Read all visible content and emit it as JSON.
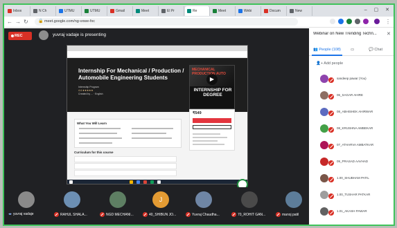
{
  "browser": {
    "tabs": [
      {
        "label": "Inbox",
        "favicon": "gmail-icon",
        "color": "#d93025"
      },
      {
        "label": "N Ch",
        "favicon": "page-icon",
        "color": "#5f6368"
      },
      {
        "label": "UTMU",
        "favicon": "page-icon",
        "color": "#1a73e8"
      },
      {
        "label": "UTMU",
        "favicon": "sheets-icon",
        "color": "#188038"
      },
      {
        "label": "Gmail",
        "favicon": "gmail-icon",
        "color": "#d93025"
      },
      {
        "label": "Meet",
        "favicon": "meet-icon",
        "color": "#00897b"
      },
      {
        "label": "El Pr",
        "favicon": "page-icon",
        "color": "#5f6368"
      },
      {
        "label": "Re",
        "favicon": "meet-icon",
        "color": "#00897b"
      },
      {
        "label": "Meet",
        "favicon": "meet-icon",
        "color": "#188038"
      },
      {
        "label": "Webi",
        "favicon": "page-icon",
        "color": "#1a73e8"
      },
      {
        "label": "Docum",
        "favicon": "youtube-icon",
        "color": "#d93025"
      },
      {
        "label": "New",
        "favicon": "page-icon",
        "color": "#5f6368"
      }
    ],
    "url": "meet.google.com/ng-vxwe-fxc",
    "window_controls": "–  ▢  ✕"
  },
  "meet": {
    "rec_label": "REC",
    "presenting_text": "yuvraj vadaje is presenting"
  },
  "shared_screen": {
    "course_title": "Internship For Mechanical / Production / Automobile Engineering Students",
    "course_meta_1": "Internship Program",
    "course_rating": "4.4 ★★★★★",
    "course_meta_2": "Created by ... · English",
    "preview_overlay": "MECHANICAL PRODUCTION AUTO",
    "preview_text": "INTERNSHIP FOR DEGREE",
    "price": "₹549",
    "learn_title": "What You Will Learn",
    "curriculum_title": "Curriculum for this course"
  },
  "participants_strip": [
    {
      "name": "yuvraj vadaje",
      "avatar_color": "#8a8a8a",
      "muted": false
    },
    {
      "name": "RAHUL SHALA...",
      "avatar_color": "#6c8fb3",
      "muted": true
    },
    {
      "name": "NGD MECHANI...",
      "avatar_color": "#5e7f63",
      "muted": true
    },
    {
      "name": "40_SHIBUN JO...",
      "avatar_color": "#e39b33",
      "muted": true,
      "initial": "J"
    },
    {
      "name": "Yuvraj Chaudha...",
      "avatar_color": "#6f86a5",
      "muted": true
    },
    {
      "name": "70_ROHIT GAN...",
      "avatar_color": "#4a4a4a",
      "muted": true
    },
    {
      "name": "manoj patil",
      "avatar_color": "#5d7d9a",
      "muted": true
    }
  ],
  "panel": {
    "title": "Webinar on New Trending Techn...",
    "tab_people": "People (108)",
    "tab_chat": "Chat",
    "add_people": "Add people",
    "people": [
      {
        "name": "sandeep pawar (You)",
        "avatar_color": "#8e44ad"
      },
      {
        "name": "06_SAGAR AHIRE",
        "avatar_color": "#8d6e63"
      },
      {
        "name": "08_ABHISHEK AHIRWAR",
        "avatar_color": "#5c6bc0"
      },
      {
        "name": "08_KRUSHNA AMBEKAR",
        "avatar_color": "#43a047"
      },
      {
        "name": "07_ATHARVA AMBATKAR",
        "avatar_color": "#ad1457"
      },
      {
        "name": "09_PRASAD AAVHAD",
        "avatar_color": "#c62828"
      },
      {
        "name": "1.00_SHUBHAM PATIL",
        "avatar_color": "#795548"
      },
      {
        "name": "1.00_TUSHAR PATKAR",
        "avatar_color": "#9e9e9e"
      },
      {
        "name": "1.01_AKASH PAWAR",
        "avatar_color": "#616161"
      }
    ]
  }
}
